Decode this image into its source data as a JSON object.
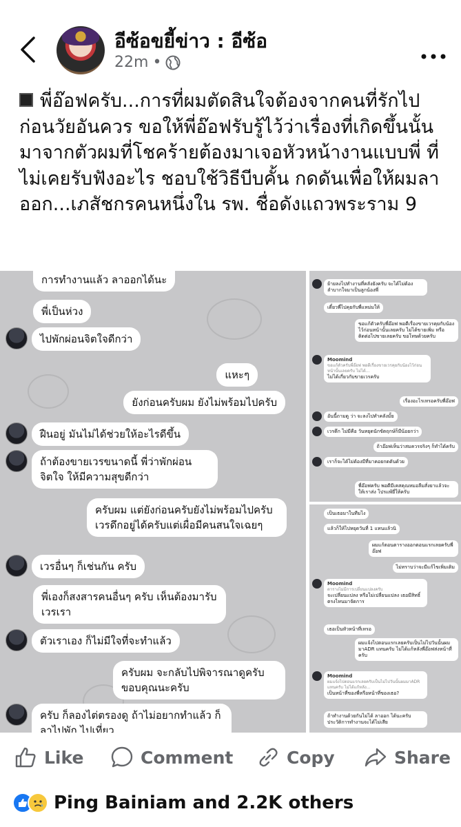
{
  "header": {
    "back_icon": "chevron-left-icon",
    "page_name": "อีซ้อขยี้ข่าว : อีซ้อ",
    "time": "22m",
    "separator": "•",
    "privacy_icon": "globe-icon",
    "more_icon": "more-dots-icon"
  },
  "post": {
    "text": "พี่อ๊อฟครับ...การที่ผมตัดสินใจต้องจากคนที่รักไปก่อนวัยอันควร ขอให้พี่อ๊อฟรับรู้ไว้ว่าเรื่องที่เกิดขึ้นนั้นมาจากตัวผมที่โชคร้ายต้องมาเจอหัวหน้างานแบบพี่ ที่ไม่เคยรับฟังอะไร ชอบใช้วิธีบีบคั้น กดดันเพื่อให้ผมลาออก...เภสัชกรคนหนึ่งใน รพ. ชื่อดังแถวพระราม 9"
  },
  "chat_left": {
    "messages": [
      {
        "side": "in",
        "text": "การทำงานแล้ว ลาออกได้นะ"
      },
      {
        "side": "in",
        "text": "พี่เป็นห่วง"
      },
      {
        "side": "in",
        "text": "ไปพักผ่อนจิตใจดีกว่า"
      },
      {
        "side": "out",
        "text": "แหะๆ"
      },
      {
        "side": "out",
        "text": "ยังก่อนครับผม ยังไม่พร้อมไปครับ"
      },
      {
        "side": "in",
        "text": "ฝืนอยู่ มันไม่ได้ช่วยให้อะไรดีขึ้น"
      },
      {
        "side": "in",
        "text": "ถ้าต้องขายเวรขนาดนี้ พี่ว่าพักผ่อนจิตใจ ให้มีความสุขดีกว่า"
      },
      {
        "side": "out",
        "text": "ครับผม แต่ยังก่อนครับยังไม่พร้อมไปครับ เวรดึกอยู่ได้ครับแต่เผื่อมีคนสนใจเฉยๆ"
      },
      {
        "side": "in",
        "text": "เวรอื่นๆ ก็เช่นกัน ครับ"
      },
      {
        "side": "in",
        "text": "พี่เองก็สงสารคนอื่นๆ ครับ เห็นต้องมารับเวรเรา"
      },
      {
        "side": "in",
        "text": "ตัวเราเอง ก็ไม่มีใจที่จะทำแล้ว"
      },
      {
        "side": "out",
        "text": "ครับผม จะกลับไปพิจารณาดูครับ ขอบคุณนะครับ"
      },
      {
        "side": "in",
        "text": "ครับ ก็ลองไต่ตรองดู ถ้าไม่อยากทำแล้ว ก็ลาไปพัก ไปเที่ยว"
      }
    ]
  },
  "chat_right_top": {
    "messages": [
      {
        "side": "in",
        "text": "ย้ายลงไปทำงานที่คลังยังครับ จะได้ไม่ต้องลำบากใจมาเป็นลูกน้องพี่"
      },
      {
        "side": "in",
        "text": "เดี๋ยวพี่ไปคุยกับพี่แหม่มให้"
      },
      {
        "side": "out",
        "text": "ขอแก้ตัวครับพี่อ๊อฟ พอดีเรื่องขายเวรคุยกับน้องไว้ก่อนหน้านั้นเลยครับ ไม่ได้ขายเพิ่ม หรือติดต่อไปขายเลยครับ ขอโทษด้วยครับ"
      },
      {
        "side": "in",
        "name": "Moomind",
        "quote": "ขอแก้ตัวครับพี่อ๊อฟ พอดีเรื่องขายเวรคุยกับน้องไว้ก่อนหน้านั้นเลยครับ ไม่ได้...",
        "text": "ไม่ได้เกี่ยวกับขายเวรครับ"
      },
      {
        "side": "out",
        "text": "เรื่องอะไรเหรอครับพี่อ๊อฟ"
      },
      {
        "side": "in",
        "text": "อันนี้ถามดู ว่า จะลงไปทำคลังมั้ย"
      },
      {
        "side": "in",
        "text": "เวรดึก ไม่มีคือ วันหยุดนักขัตฤกษ์ก็มีน้อยกว่า"
      },
      {
        "side": "out",
        "text": "ถ้าอ๊อฟเห็นว่าสมควรจริงๆ ก็ทำได้ครับ"
      },
      {
        "side": "in",
        "text": "เราก็จะได้ไม่ต้องมีที่มาคอยกดดันด้วย"
      },
      {
        "side": "out",
        "text": "พี่อ๊อฟครับ พอดีมีเคสคุณหมอลืมสั่งยาแล้วจะให้เราส่ง โปรแพ้ยี่ให้ครับ"
      }
    ]
  },
  "chat_right_bot": {
    "messages": [
      {
        "side": "in",
        "text": "เป็นเธอมาในทีมไง"
      },
      {
        "side": "in",
        "text": "แล้วก็ให้ไปหยุดวันที่ 1 แทนแล้วนิ"
      },
      {
        "side": "out",
        "text": "ผมแก้ตอนตารางออกตอนแรกเลยครับพี่อ๊อฟ"
      },
      {
        "side": "out",
        "text": "ไม่ทราบว่าจะมีแก้ไขเพิ่มเติม"
      },
      {
        "side": "in",
        "name": "Moomind",
        "quote": "ตารางไม่มีการเปลี่ยนแปลงครับ",
        "text": "จะเปลี่ยนแปลง หรือไม่เปลี่ยนแปลง เธอมีสิทธิ์ตรงไหนมาจัดการ"
      },
      {
        "side": "in",
        "text": "เธอเป็นหัวหน้าที่เหรอ"
      },
      {
        "side": "out",
        "text": "ผมแจ้งไปตอนแรกเลยครับเป็นไม่ไปวันนั้นผมมาADR แทนครับ ไม่ได้แก้หลังพี่อ๊อฟส่งหน้าที่ครับ"
      },
      {
        "side": "in",
        "name": "Moomind",
        "quote": "ผมแจ้งไปตอนแรกเลยครับเป็นไม่ไปวันนั้นผมมาADR แทนครับ ไม่ได้แก้หลัง...",
        "text": "เป็นหน้าที่ของพี่หรือหน้าที่ของเธอ?"
      },
      {
        "side": "in",
        "text": "ถ้าทำงานด้วยกันไม่ได้ ลาออก ได้นะครับ ประวัติการทำงานจะได้ไม่เสีย"
      }
    ]
  },
  "actions": {
    "like": {
      "label": "Like",
      "icon": "thumbs-up-icon"
    },
    "comment": {
      "label": "Comment",
      "icon": "comment-bubble-icon"
    },
    "copy": {
      "label": "Copy",
      "icon": "link-icon"
    },
    "share": {
      "label": "Share",
      "icon": "share-arrow-icon"
    }
  },
  "reactions": {
    "icons": [
      "like-reaction-icon",
      "sad-reaction-icon"
    ],
    "text": "Ping Bainiam and 2.2K others"
  },
  "colors": {
    "accent": "#1877f2",
    "muted": "#65676b",
    "chat_bg": "#c7c7c9",
    "sad": "#f7c83c"
  }
}
